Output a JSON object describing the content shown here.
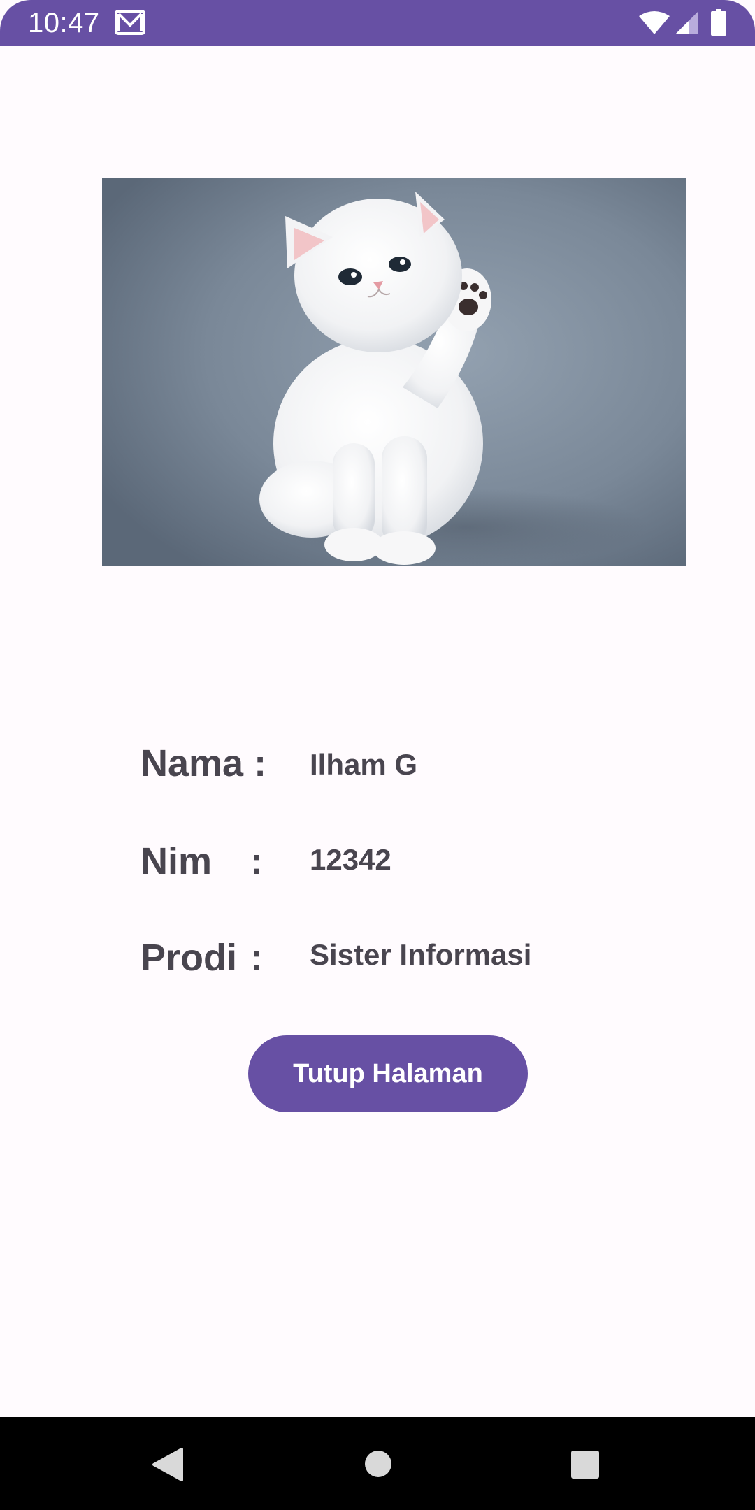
{
  "status_bar": {
    "time": "10:47",
    "color": "#6750a4",
    "icons": [
      "gmail-icon",
      "wifi-icon",
      "signal-icon",
      "battery-icon"
    ]
  },
  "photo": {
    "subject": "kitten-photo"
  },
  "profile": {
    "name_label": "Nama :",
    "name_value": "Ilham G",
    "nim_label": "Nim",
    "nim_value": "12342",
    "prodi_label": "Prodi",
    "prodi_value": "Sister Informasi",
    "colon": ":"
  },
  "button": {
    "label": "Tutup Halaman",
    "color": "#6750a4"
  },
  "nav_bar": {
    "icons": [
      "back-icon",
      "home-icon",
      "recents-icon"
    ]
  },
  "colors": {
    "background": "#fffbfe",
    "text": "#49454f",
    "accent": "#6750a4"
  }
}
